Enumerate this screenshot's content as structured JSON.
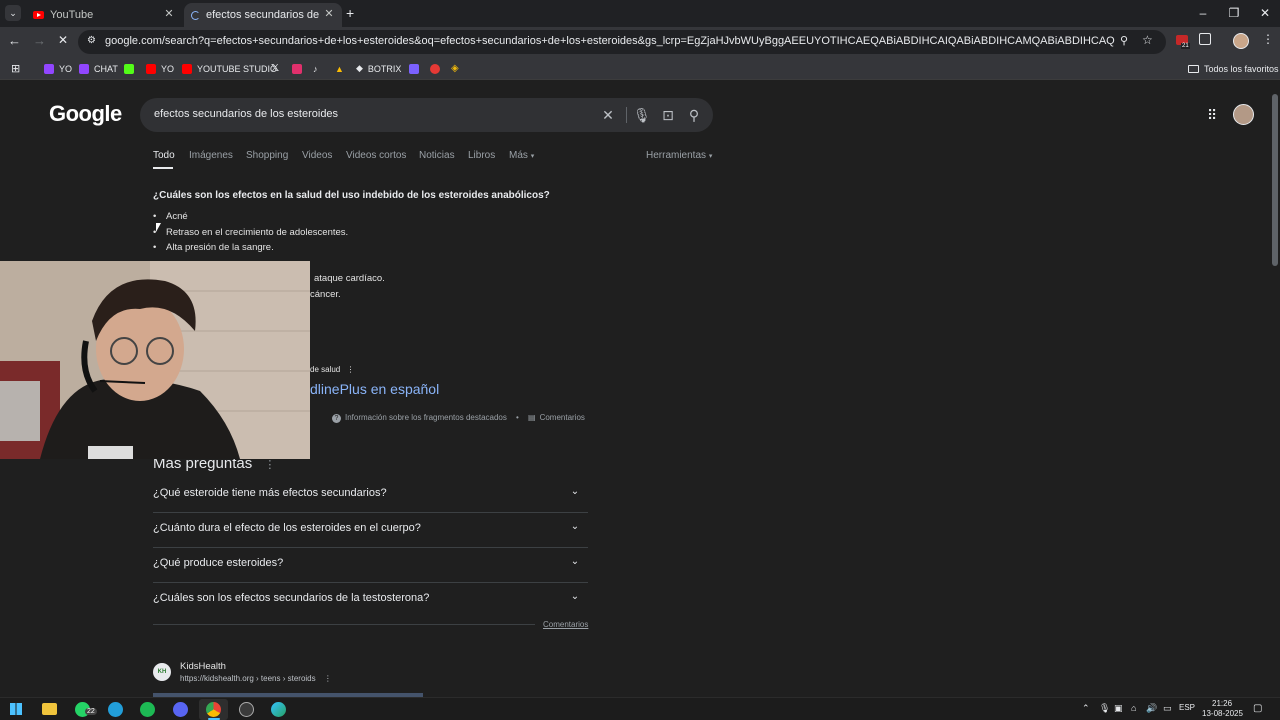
{
  "browser": {
    "tabs": [
      {
        "title": "YouTube",
        "active": false
      },
      {
        "title": "efectos secundarios de los este",
        "active": true
      }
    ],
    "new_tab_symbol": "+",
    "address": "google.com/search?q=efectos+secundarios+de+los+esteroides&oq=efectos+secundarios+de+los+esteroides&gs_lcrp=EgZjaHJvbWUyBggAEEUYOTIHCAEQABiABDIHCAIQABiABDIHCAMQABiABDIHCAQQABiABDIHCAUQABiABDIHCAYQABiAB...",
    "extension_badge": "21",
    "bookmarks": [
      {
        "label": "YO",
        "icon": "twitch-icon",
        "color": "#9146ff"
      },
      {
        "label": "CHAT",
        "icon": "twitch-icon",
        "color": "#9146ff"
      },
      {
        "label": "",
        "icon": "kick-icon",
        "color": "#53fc18"
      },
      {
        "label": "YO",
        "icon": "youtube-icon",
        "color": "#ff0000"
      },
      {
        "label": "YOUTUBE STUDIO",
        "icon": "youtube-icon",
        "color": "#ff0000"
      },
      {
        "label": "",
        "icon": "x-icon",
        "color": "#ffffff"
      },
      {
        "label": "",
        "icon": "instagram-icon",
        "color": "#e1306c"
      },
      {
        "label": "",
        "icon": "tiktok-icon",
        "color": "#ffffff"
      },
      {
        "label": "",
        "icon": "drive-icon",
        "color": "#34a853"
      },
      {
        "label": "BOTRIX",
        "icon": "botrix-icon",
        "color": "#ffffff"
      },
      {
        "label": "",
        "icon": "s-icon",
        "color": "#7b61ff"
      },
      {
        "label": "",
        "icon": "circle-icon",
        "color": "#e53935"
      },
      {
        "label": "",
        "icon": "binance-icon",
        "color": "#f0b90b"
      }
    ],
    "all_bookmarks_label": "Todos los favoritos"
  },
  "google": {
    "logo": "Google",
    "query": "efectos secundarios de los esteroides",
    "tabs": [
      "Todo",
      "Imágenes",
      "Shopping",
      "Videos",
      "Videos cortos",
      "Noticias",
      "Libros",
      "Más"
    ],
    "tools": "Herramientas",
    "snippet": {
      "question": "¿Cuáles son los efectos en la salud del uso indebido de los esteroides anabólicos?",
      "items": [
        "Acné",
        "Retraso en el crecimiento de adolescentes.",
        "Alta presión de la sangre.",
        "ataque cardíaco.",
        "cáncer."
      ],
      "source_fragment": "de salud",
      "link_fragment": "dlinePlus en español",
      "about": "Información sobre los fragmentos destacados",
      "feedback": "Comentarios"
    },
    "paa_title": "Más preguntas",
    "paa": [
      "¿Qué esteroide tiene más efectos secundarios?",
      "¿Cuánto dura el efecto de los esteroides en el cuerpo?",
      "¿Qué produce esteroides?",
      "¿Cuáles son los efectos secundarios de la testosterona?"
    ],
    "paa_feedback": "Comentarios",
    "result": {
      "site": "KidsHealth",
      "favicon_text": "KH",
      "url": "https://kidshealth.org › teens › steroids"
    }
  },
  "taskbar": {
    "whatsapp_badge": "22",
    "lang": "ESP",
    "time": "21:26",
    "date": "13-08-2025"
  }
}
